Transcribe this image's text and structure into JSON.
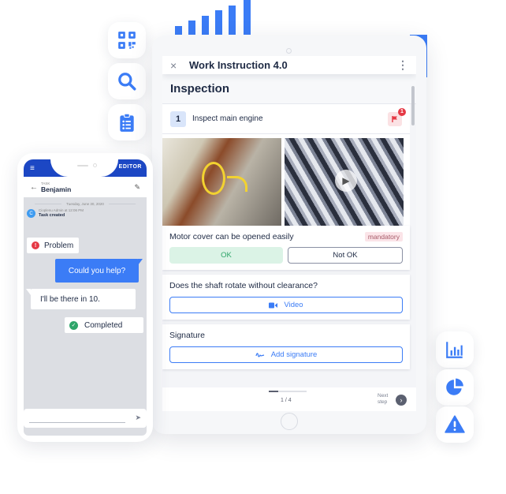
{
  "decor": {
    "bar_fractions": [
      0.25,
      0.4,
      0.55,
      0.7,
      0.85,
      1.0
    ],
    "accent": "#3b7cf6"
  },
  "floating_icons_left": [
    {
      "name": "qr-code-icon"
    },
    {
      "name": "search-icon"
    },
    {
      "name": "clipboard-list-icon"
    }
  ],
  "floating_icons_right": [
    {
      "name": "bar-chart-icon"
    },
    {
      "name": "pie-chart-icon"
    },
    {
      "name": "warning-icon"
    }
  ],
  "tablet": {
    "close_icon": "×",
    "title": "Work Instruction 4.0",
    "more_icon": "⋮",
    "section_title": "Inspection",
    "step": {
      "number": "1",
      "label": "Inspect main engine",
      "flag_count": "1"
    },
    "question1": {
      "text": "Motor cover can be opened easily",
      "badge": "mandatory",
      "ok_label": "OK",
      "not_ok_label": "Not OK"
    },
    "question2": {
      "text": "Does the shaft rotate without clearance?",
      "button_label": "Video"
    },
    "signature": {
      "title": "Signature",
      "button_label": "Add signature"
    },
    "footer": {
      "progress_fraction": 0.25,
      "page_label": "1 / 4",
      "next_label_line1": "Next",
      "next_label_line2": "step",
      "next_icon": "›"
    }
  },
  "phone": {
    "menu_icon": "≡",
    "mode_label": "EDITOR",
    "back_icon": "←",
    "task_label": "TASK",
    "task_name": "Benjamin",
    "edit_icon": "✎",
    "date": "Tuesday, June 30, 2020",
    "system_message": {
      "avatar_letter": "C",
      "author": "Cioplenu Admin at 12:06 PM",
      "text": "Task created"
    },
    "messages": {
      "problem": "Problem",
      "problem_icon": "!",
      "help": "Could you help?",
      "reply": "I'll be there in 10.",
      "completed": "Completed",
      "completed_icon": "✓"
    },
    "send_icon": "➤"
  }
}
